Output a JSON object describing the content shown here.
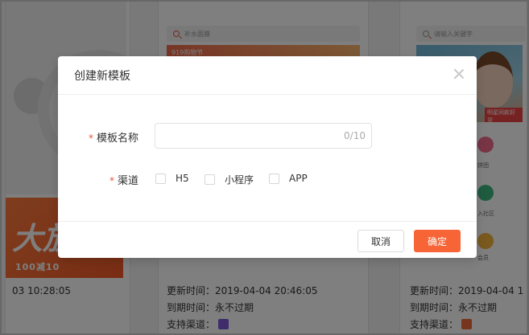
{
  "background": {
    "card1": {
      "ad_big_text": "大放",
      "ad_small_text": "100减10",
      "update_time": "03 10:28:05"
    },
    "card2": {
      "search_placeholder": "补水面膜",
      "ad_label": "919购物节",
      "update_label": "更新时间：",
      "update_time": "2019-04-04 20:46:05",
      "expire_label": "到期时间：",
      "expire_value": "永不过期",
      "channel_label": "支持渠道："
    },
    "card3": {
      "search_placeholder": "请输入关键字",
      "ad_tag": "明星同款好货",
      "icon_labels": [
        "拼团",
        "入社区",
        "会员"
      ],
      "update_label": "更新时间：",
      "update_time": "2019-04-04 1",
      "expire_label": "到期时间：",
      "expire_value": "永不过期",
      "channel_label": "支持渠道："
    }
  },
  "dialog": {
    "title": "创建新模板",
    "name_field": {
      "label": "模板名称",
      "required_mark": "*",
      "value": "",
      "placeholder": "",
      "counter": "0/10"
    },
    "channel_field": {
      "label": "渠道",
      "required_mark": "*",
      "options": [
        {
          "label": "H5",
          "checked": false
        },
        {
          "label": "小程序",
          "checked": false
        },
        {
          "label": "APP",
          "checked": false
        }
      ]
    },
    "cancel_label": "取消",
    "confirm_label": "确定"
  },
  "colors": {
    "accent": "#f76537",
    "required": "#e8543a",
    "mask": "rgba(0,0,0,0.5)"
  }
}
